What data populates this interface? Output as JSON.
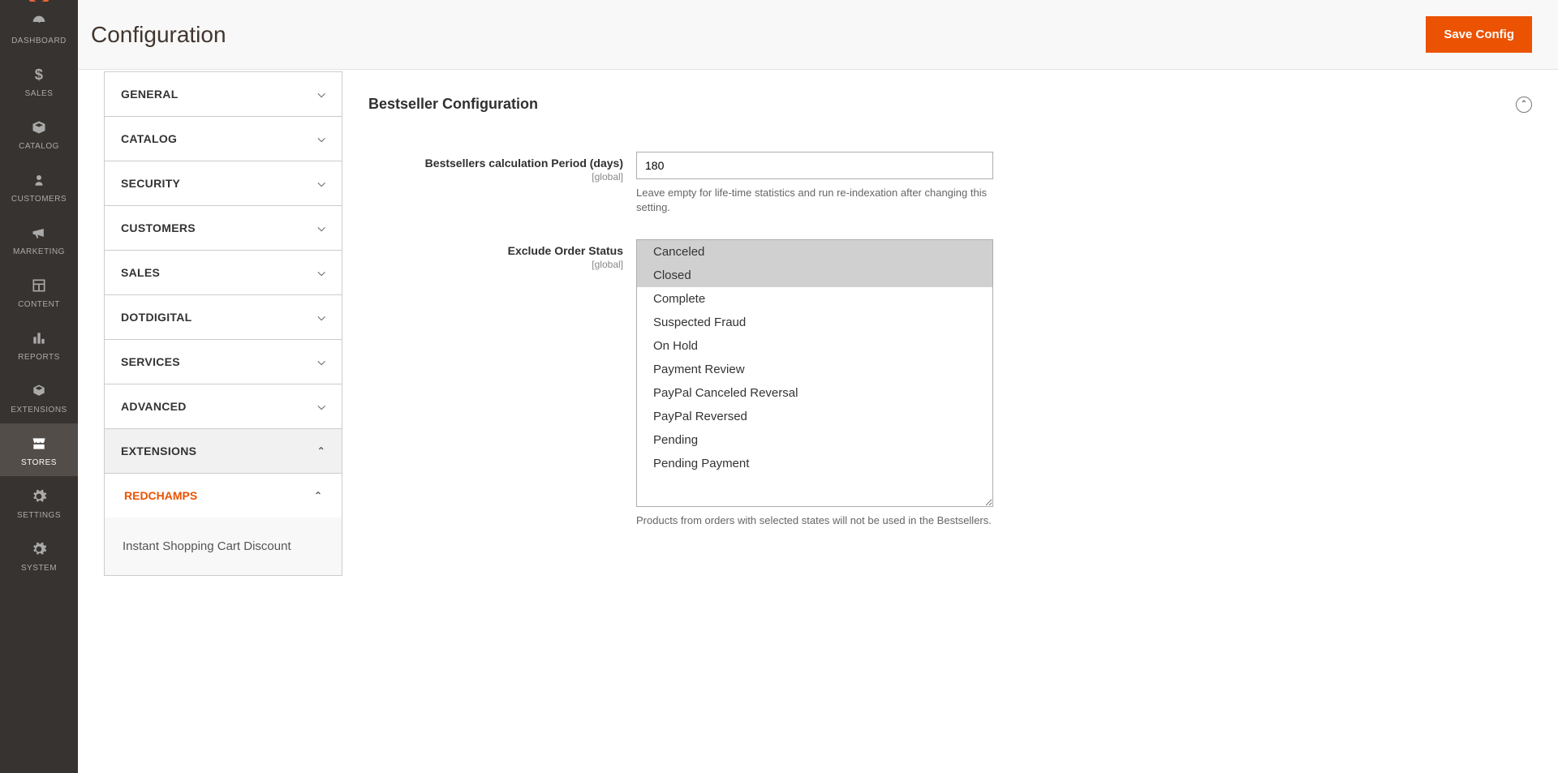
{
  "page": {
    "title": "Configuration",
    "save_label": "Save Config"
  },
  "sidebar": {
    "items": [
      {
        "label": "DASHBOARD"
      },
      {
        "label": "SALES"
      },
      {
        "label": "CATALOG"
      },
      {
        "label": "CUSTOMERS"
      },
      {
        "label": "MARKETING"
      },
      {
        "label": "CONTENT"
      },
      {
        "label": "REPORTS"
      },
      {
        "label": "EXTENSIONS"
      },
      {
        "label": "STORES"
      },
      {
        "label": "SETTINGS"
      },
      {
        "label": "SYSTEM"
      }
    ]
  },
  "tabs": {
    "general": "GENERAL",
    "catalog": "CATALOG",
    "security": "SECURITY",
    "customers": "CUSTOMERS",
    "sales": "SALES",
    "dotdigital": "DOTDIGITAL",
    "services": "SERVICES",
    "advanced": "ADVANCED",
    "extensions": "EXTENSIONS",
    "redchamps": "REDCHAMPS",
    "instant_shopping": "Instant Shopping Cart Discount"
  },
  "form": {
    "section_title": "Bestseller Configuration",
    "period": {
      "label": "Bestsellers calculation Period (days)",
      "scope": "[global]",
      "value": "180",
      "note": "Leave empty for life-time statistics and run re-indexation after changing this setting."
    },
    "exclude": {
      "label": "Exclude Order Status",
      "scope": "[global]",
      "options": [
        {
          "label": "Canceled",
          "selected": true
        },
        {
          "label": "Closed",
          "selected": true
        },
        {
          "label": "Complete",
          "selected": false
        },
        {
          "label": "Suspected Fraud",
          "selected": false
        },
        {
          "label": "On Hold",
          "selected": false
        },
        {
          "label": "Payment Review",
          "selected": false
        },
        {
          "label": "PayPal Canceled Reversal",
          "selected": false
        },
        {
          "label": "PayPal Reversed",
          "selected": false
        },
        {
          "label": "Pending",
          "selected": false
        },
        {
          "label": "Pending Payment",
          "selected": false
        }
      ],
      "note": "Products from orders with selected states will not be used in the Bestsellers."
    }
  }
}
